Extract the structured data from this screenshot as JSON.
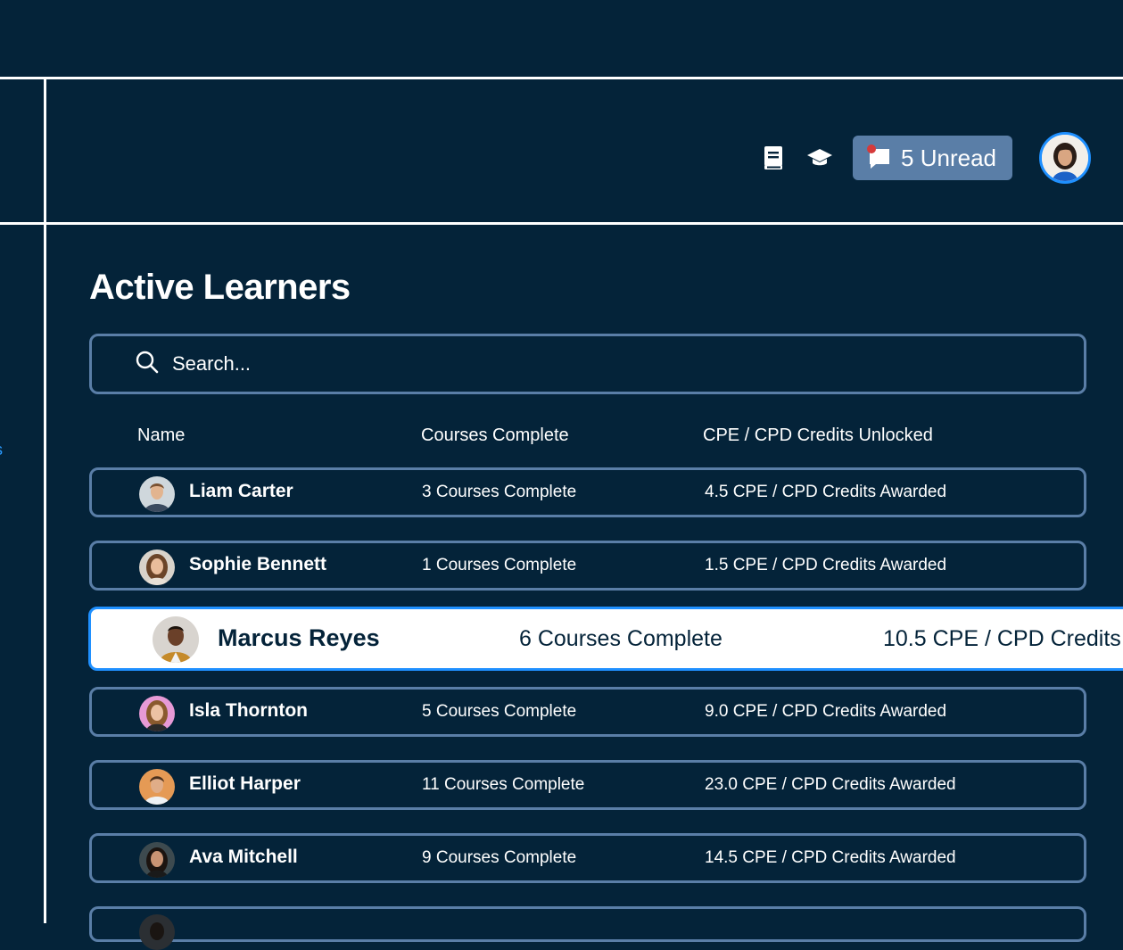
{
  "sidebar": {
    "partial_label": "s"
  },
  "header": {
    "unread_label": "5 Unread"
  },
  "main": {
    "title": "Active Learners",
    "search": {
      "placeholder": "Search..."
    },
    "columns": {
      "name": "Name",
      "courses": "Courses Complete",
      "credits": "CPE / CPD Credits Unlocked"
    },
    "learners": [
      {
        "name": "Liam Carter",
        "courses": "3 Courses Complete",
        "credits": "4.5 CPE / CPD Credits Awarded"
      },
      {
        "name": "Sophie Bennett",
        "courses": "1 Courses Complete",
        "credits": "1.5 CPE / CPD Credits Awarded"
      },
      {
        "name": "Marcus Reyes",
        "courses": "6 Courses Complete",
        "credits": "10.5 CPE / CPD Credits"
      },
      {
        "name": "Isla Thornton",
        "courses": "5 Courses Complete",
        "credits": "9.0 CPE / CPD Credits Awarded"
      },
      {
        "name": "Elliot Harper",
        "courses": "11 Courses Complete",
        "credits": "23.0 CPE / CPD Credits Awarded"
      },
      {
        "name": "Ava Mitchell",
        "courses": "9 Courses Complete",
        "credits": "14.5 CPE / CPD Credits Awarded"
      }
    ]
  },
  "colors": {
    "background": "#042339",
    "accent": "#1f90ff",
    "border": "#5a7ea7",
    "notification_dot": "#d63a3a"
  }
}
